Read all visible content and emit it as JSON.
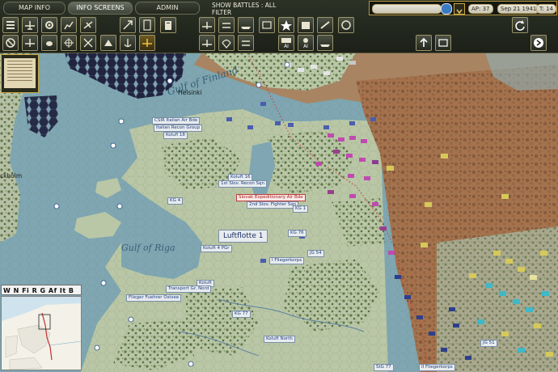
{
  "tabs": [
    {
      "label": "MAP INFO"
    },
    {
      "label": "INFO SCREENS"
    },
    {
      "label": "ADMIN"
    }
  ],
  "filter": {
    "line1": "SHOW BATTLES : ALL",
    "line2": "FILTER"
  },
  "status": {
    "ap": "AP: 37",
    "date": "Sep 21 1941",
    "turn": "T: 14",
    "ai_label": "AI"
  },
  "minimap": {
    "legend": "W N Fi R G Af It B"
  },
  "map": {
    "geo_labels": {
      "gulf_finland": "Gulf of Finland",
      "gulf_riga": "Gulf of Riga"
    },
    "cities": {
      "helsinki": "Helsinki",
      "stockholm": "ckholm"
    },
    "air_labels": {
      "csir": "CSIR Italian Air Bde",
      "italian_recon": "Italian Recon Group",
      "kolufi18": "Kolufi 18",
      "kolufi16": "Koluft 16",
      "slov_recon": "1st Slov. Recon Sqn",
      "kg4": "KG 4",
      "slovak_exp": "Slovak Expeditionary Air Bde",
      "slov_fighter": "2nd Slov. Fighter Sqn",
      "kg1": "KG 1",
      "kg76": "KG 76",
      "luftflotte": "Luftflotte 1",
      "koluft4": "Koluft 4 PGr",
      "jg54": "JG 54",
      "fliegerkorps": "I Fliegerkorps",
      "koluft": "Koluft",
      "transport": "Transport Gr. Nord",
      "fuehrer": "Flieger Fuehrer Ostsee",
      "kg77": "KG 77",
      "koluft_north": "Koluft North",
      "stg77": "StG 77",
      "fliegerkorps2": "II Fliegerkorps",
      "jg51": "JG 51"
    }
  },
  "colors": {
    "water": "#7fa6b2",
    "plains": "#b9c7a6",
    "forest": "#5b6e3f",
    "soviet_zone": "#a5714c",
    "axis_unit": "#c04ab0",
    "german_air": "#2e3f8a",
    "soviet_unit": "#d6c95a"
  }
}
